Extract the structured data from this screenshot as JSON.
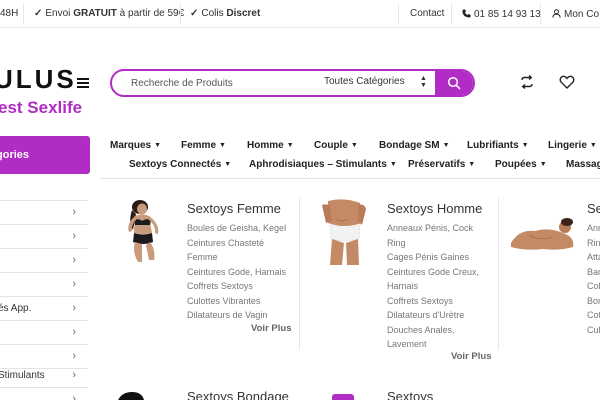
{
  "topbar": {
    "partial_left": "48H",
    "envoi_prefix": "Envoi",
    "envoi_bold": "GRATUIT",
    "envoi_suffix": "à partir de 59€",
    "colis_prefix": "Colis",
    "colis_bold": "Discret",
    "contact": "Contact",
    "phone": "01 85 14 93 13",
    "account": "Mon Co"
  },
  "header": {
    "logo": "ULUS",
    "tagline": "est Sexlife",
    "search_placeholder": "Recherche de Produits",
    "search_category": "Toutes Catégories"
  },
  "sidebar": {
    "categories_label": "gories",
    "items": [
      {
        "label": ""
      },
      {
        "label": ""
      },
      {
        "label": ""
      },
      {
        "label": ""
      },
      {
        "label": "és App."
      },
      {
        "label": ""
      },
      {
        "label": ""
      },
      {
        "label": "Stimulants"
      },
      {
        "label": ""
      }
    ]
  },
  "nav": {
    "row1": [
      {
        "label": "Marques"
      },
      {
        "label": "Femme"
      },
      {
        "label": "Homme"
      },
      {
        "label": "Couple"
      },
      {
        "label": "Bondage SM"
      },
      {
        "label": "Lubrifiants"
      },
      {
        "label": "Lingerie"
      }
    ],
    "row2": [
      {
        "label": "Sextoys Connectés"
      },
      {
        "label": "Aphrodisiaques – Stimulants"
      },
      {
        "label": "Préservatifs"
      },
      {
        "label": "Poupées"
      },
      {
        "label": "Massag"
      }
    ]
  },
  "categories": [
    {
      "title": "Sextoys Femme",
      "links": [
        "Boules de Geisha, Kegel",
        "Ceintures Chasteté",
        "Femme",
        "Ceintures Gode, Harnais",
        "Coffrets Sextoys",
        "Culottes Vibrantes",
        "Dilatateurs de Vagin"
      ],
      "more": "Voir Plus"
    },
    {
      "title": "Sextoys Homme",
      "links": [
        "Anneaux Pénis, Cock",
        "Ring",
        "Cages Pénis Gaines",
        "Ceintures Gode Creux,",
        "Harnais",
        "Coffrets Sextoys",
        "Dilatateurs d'Urètre",
        "Douches Anales,",
        "Lavement"
      ],
      "more": "Voir Plus"
    },
    {
      "title": "Se",
      "links": [
        "Ann",
        "Rin",
        "Atta",
        "Ban",
        "Coll",
        "Bon",
        "Cof",
        "Cul"
      ],
      "more": ""
    }
  ],
  "bottom_titles": [
    "Sextoys Bondage",
    "Sextoys"
  ],
  "colors": {
    "accent": "#b12cc5",
    "border": "#e3e3e3"
  }
}
